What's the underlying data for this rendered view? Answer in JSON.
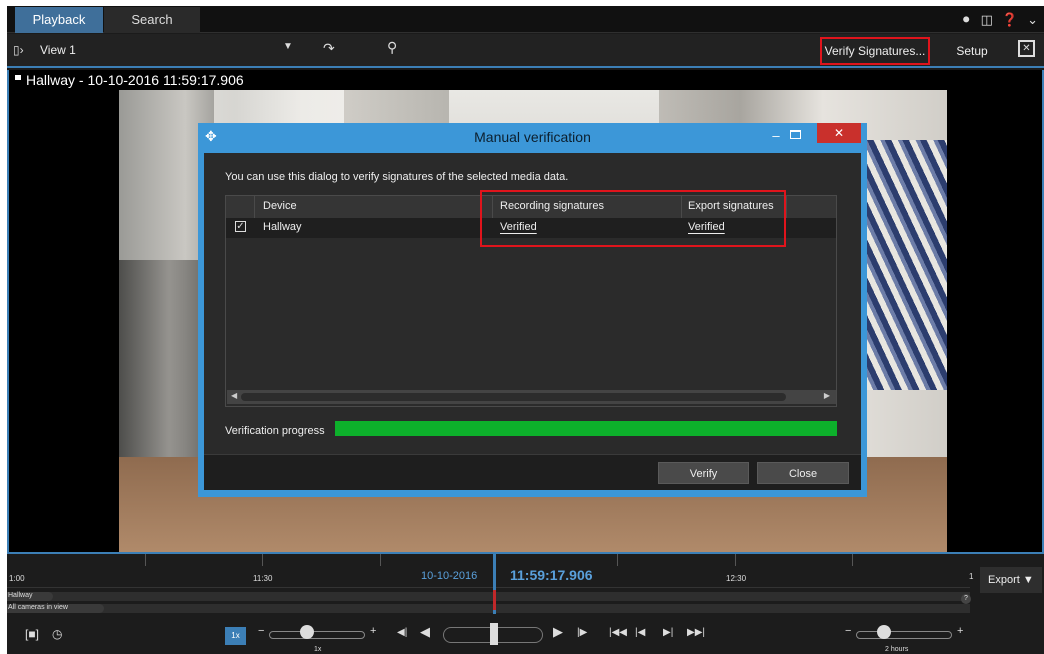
{
  "tabs": [
    {
      "label": "Playback",
      "active": true
    },
    {
      "label": "Search",
      "active": false
    }
  ],
  "top_icons": [
    "headset-icon",
    "window-icon",
    "help-icon",
    "chevron-down-icon"
  ],
  "toolbar": {
    "view_label": "View 1",
    "verify_signatures_label": "Verify Signatures...",
    "setup_label": "Setup"
  },
  "camera": {
    "title": "Hallway - 10-10-2016 11:59:17.906"
  },
  "dialog": {
    "title": "Manual verification",
    "intro": "You can use this dialog to verify signatures of the selected media data.",
    "columns": {
      "device": "Device",
      "recording": "Recording signatures",
      "export": "Export signatures"
    },
    "rows": [
      {
        "checked": true,
        "device": "Hallway",
        "recording": "Verified",
        "export": "Verified"
      }
    ],
    "progress_label": "Verification progress",
    "progress": 1.0,
    "verify_label": "Verify",
    "close_label": "Close"
  },
  "timeline": {
    "labels": [
      "1:00",
      "11:30",
      "12:30"
    ],
    "date": "10-10-2016",
    "time": "11:59:17.906",
    "tracks": [
      "Hallway",
      "All cameras in view"
    ],
    "count": "1",
    "question": "?",
    "export_label": "Export"
  },
  "controls": {
    "speed_badge": "1x",
    "speed_label": "1x",
    "range_label": "2 hours"
  },
  "colors": {
    "accent": "#3c7fb6",
    "progress": "#0db02b",
    "highlight": "#e0141c",
    "dialog_frame": "#3c97d8"
  }
}
